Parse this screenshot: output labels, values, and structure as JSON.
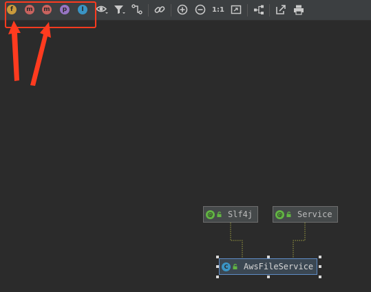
{
  "toolbar": {
    "member_filters": [
      {
        "name": "fields-filter",
        "letter": "f",
        "color": "#c99a3c"
      },
      {
        "name": "constructors-filter",
        "letter": "m",
        "color": "#c9635f"
      },
      {
        "name": "methods-filter",
        "letter": "m",
        "color": "#c9635f"
      },
      {
        "name": "properties-filter",
        "letter": "p",
        "color": "#9775c4"
      },
      {
        "name": "inner-classes-filter",
        "letter": "I",
        "color": "#3a94c4"
      }
    ],
    "actual_size_label": "1:1"
  },
  "diagram": {
    "nodes": {
      "slf4j": {
        "icon_letter": "@",
        "icon_color": "#62b543",
        "label": "Slf4j"
      },
      "service": {
        "icon_letter": "@",
        "icon_color": "#62b543",
        "label": "Service"
      },
      "aws_file_service": {
        "icon_letter": "C",
        "icon_color": "#3a94c4",
        "label": "AwsFileService"
      }
    },
    "lock_color": "#62b543",
    "edge_color": "#a0a040"
  },
  "annotation": {
    "color": "#ff3b1f"
  }
}
